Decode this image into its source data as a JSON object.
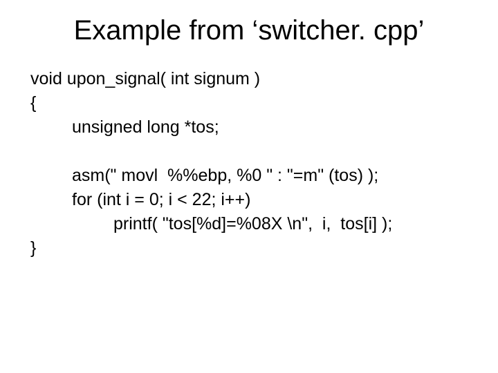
{
  "title": "Example from ‘switcher. cpp’",
  "code": {
    "line1": "void upon_signal( int signum )",
    "line2": "{",
    "line3": "unsigned long *tos;",
    "line4": "asm(\" movl  %%ebp, %0 \" : \"=m\" (tos) );",
    "line5": "for (int i = 0; i < 22; i++)",
    "line6": "printf( \"tos[%d]=%08X \\n\",  i,  tos[i] );",
    "line7": "}"
  }
}
